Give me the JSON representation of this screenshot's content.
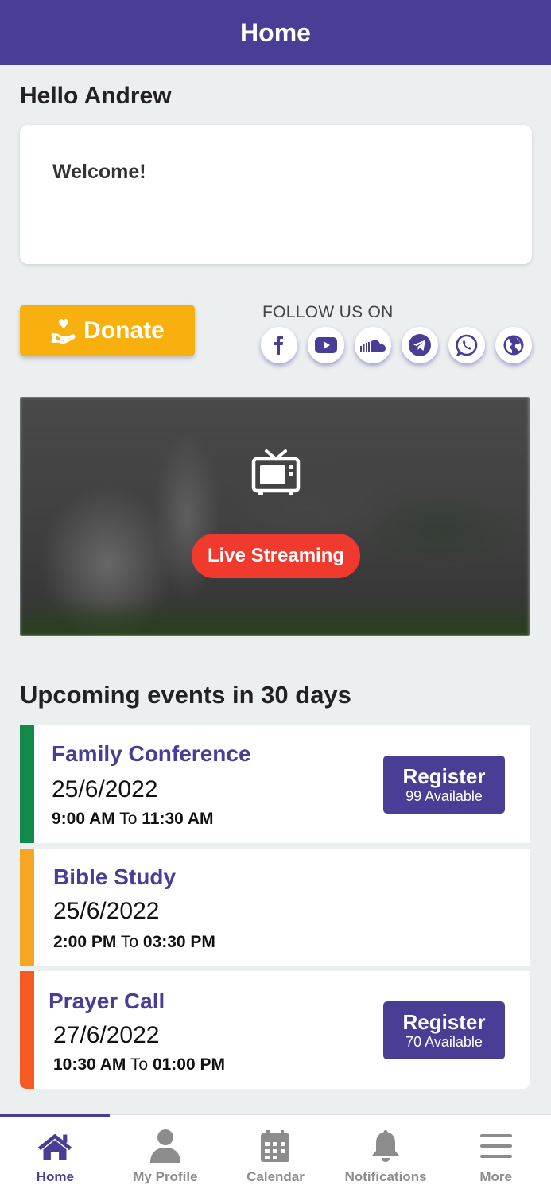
{
  "header": {
    "title": "Home"
  },
  "greeting": "Hello Andrew",
  "welcome": {
    "text": "Welcome!"
  },
  "donate": {
    "label": "Donate",
    "icon": "donate-hand-heart-icon",
    "color": "#f7b00d"
  },
  "follow": {
    "label": "FOLLOW US ON",
    "icons": [
      "facebook-icon",
      "youtube-icon",
      "soundcloud-icon",
      "telegram-icon",
      "whatsapp-icon",
      "globe-icon"
    ]
  },
  "live": {
    "label": "Live Streaming",
    "icon": "tv-icon",
    "color": "#f03a2e"
  },
  "events": {
    "heading": "Upcoming events in 30 days",
    "items": [
      {
        "name": "Family Conference",
        "date": "25/6/2022",
        "start": "9:00 AM",
        "to": "To",
        "end": "11:30 AM",
        "color": "#13894a",
        "register": {
          "label": "Register",
          "available": "99 Available"
        }
      },
      {
        "name": "Bible Study",
        "date": "25/6/2022",
        "start": "2:00 PM",
        "to": "To",
        "end": "03:30 PM",
        "color": "#f5a623"
      },
      {
        "name": "Prayer Call",
        "date": "27/6/2022",
        "start": "10:30 AM",
        "to": "To",
        "end": "01:00 PM",
        "color": "#f55a22",
        "register": {
          "label": "Register",
          "available": "70 Available"
        }
      }
    ]
  },
  "tabs": [
    {
      "label": "Home",
      "icon": "home-icon",
      "active": true
    },
    {
      "label": "My Profile",
      "icon": "user-icon"
    },
    {
      "label": "Calendar",
      "icon": "calendar-icon"
    },
    {
      "label": "Notifications",
      "icon": "bell-icon"
    },
    {
      "label": "More",
      "icon": "menu-icon"
    }
  ],
  "colors": {
    "primary": "#483e96",
    "background": "#eceff0"
  }
}
